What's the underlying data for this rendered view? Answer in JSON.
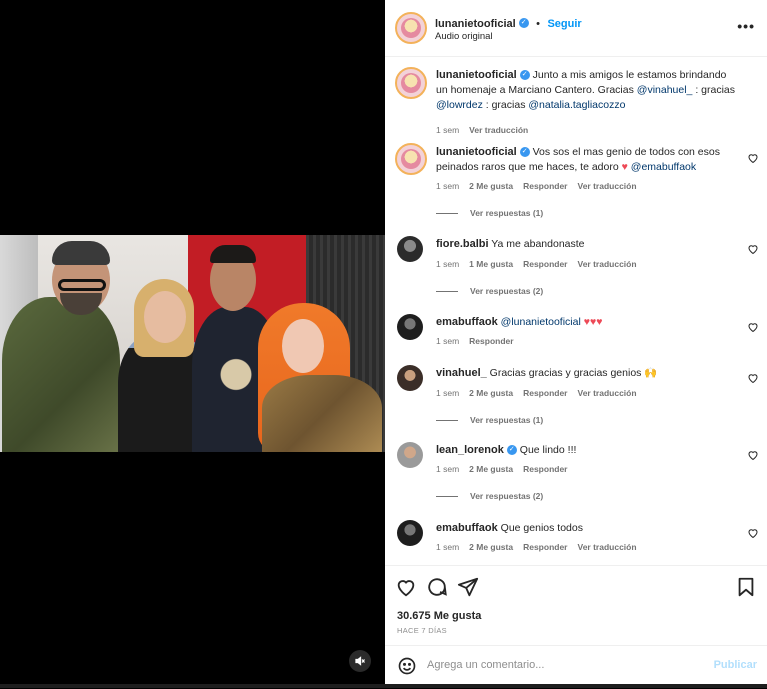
{
  "post": {
    "username": "lunanietooficial",
    "follow_label": "Seguir",
    "audio_label": "Audio original",
    "caption_user": "lunanietooficial",
    "caption_parts": [
      "Junto a mis amigos le estamos brindando un homenaje a Marciano Cantero. Gracias ",
      "@vinahuel_",
      " : gracias ",
      "@lowrdez",
      " : gracias ",
      "@natalia.tagliacozzo"
    ],
    "caption_time": "1 sem",
    "caption_translate": "Ver traducción"
  },
  "comments": [
    {
      "user": "lunanietooficial",
      "text": "Vos sos el mas genio de todos con esos peinados raros que me haces, te adoro",
      "emoji_after": "♥",
      "mention": "@emabuffaok",
      "time": "1 sem",
      "likes": "2 Me gusta",
      "reply": "Responder",
      "translate": "Ver traducción",
      "view_replies": "Ver respuestas (1)"
    },
    {
      "user": "fiore.balbi",
      "text": "Ya me abandonaste",
      "time": "1 sem",
      "likes": "1 Me gusta",
      "reply": "Responder",
      "translate": "Ver traducción",
      "view_replies": "Ver respuestas (2)"
    },
    {
      "user": "emabuffaok",
      "mention": "@lunanietooficial",
      "emoji_after": "♥♥♥",
      "time": "1 sem",
      "reply": "Responder"
    },
    {
      "user": "vinahuel_",
      "text": "Gracias gracias y gracias genios",
      "emoji_after": "🙌",
      "time": "1 sem",
      "likes": "2 Me gusta",
      "reply": "Responder",
      "translate": "Ver traducción",
      "view_replies": "Ver respuestas (1)"
    },
    {
      "user": "lean_lorenok",
      "text": "Que lindo !!!",
      "time": "1 sem",
      "likes": "2 Me gusta",
      "reply": "Responder",
      "view_replies": "Ver respuestas (2)"
    },
    {
      "user": "emabuffaok",
      "text": "Que genios todos",
      "time": "1 sem",
      "likes": "2 Me gusta",
      "reply": "Responder",
      "translate": "Ver traducción"
    }
  ],
  "footer": {
    "likes": "30.675 Me gusta",
    "date": "HACE 7 DÍAS",
    "comment_placeholder": "Agrega un comentario...",
    "post_label": "Publicar"
  },
  "icons": [
    "heart-icon",
    "comment-icon",
    "share-icon",
    "bookmark-icon",
    "emoji-icon",
    "mute-icon",
    "more-icon",
    "verified-icon"
  ],
  "colors": {
    "link": "#0095f6",
    "mention": "#00376b",
    "heart_red": "#ed4956",
    "muted_text": "#737373"
  }
}
